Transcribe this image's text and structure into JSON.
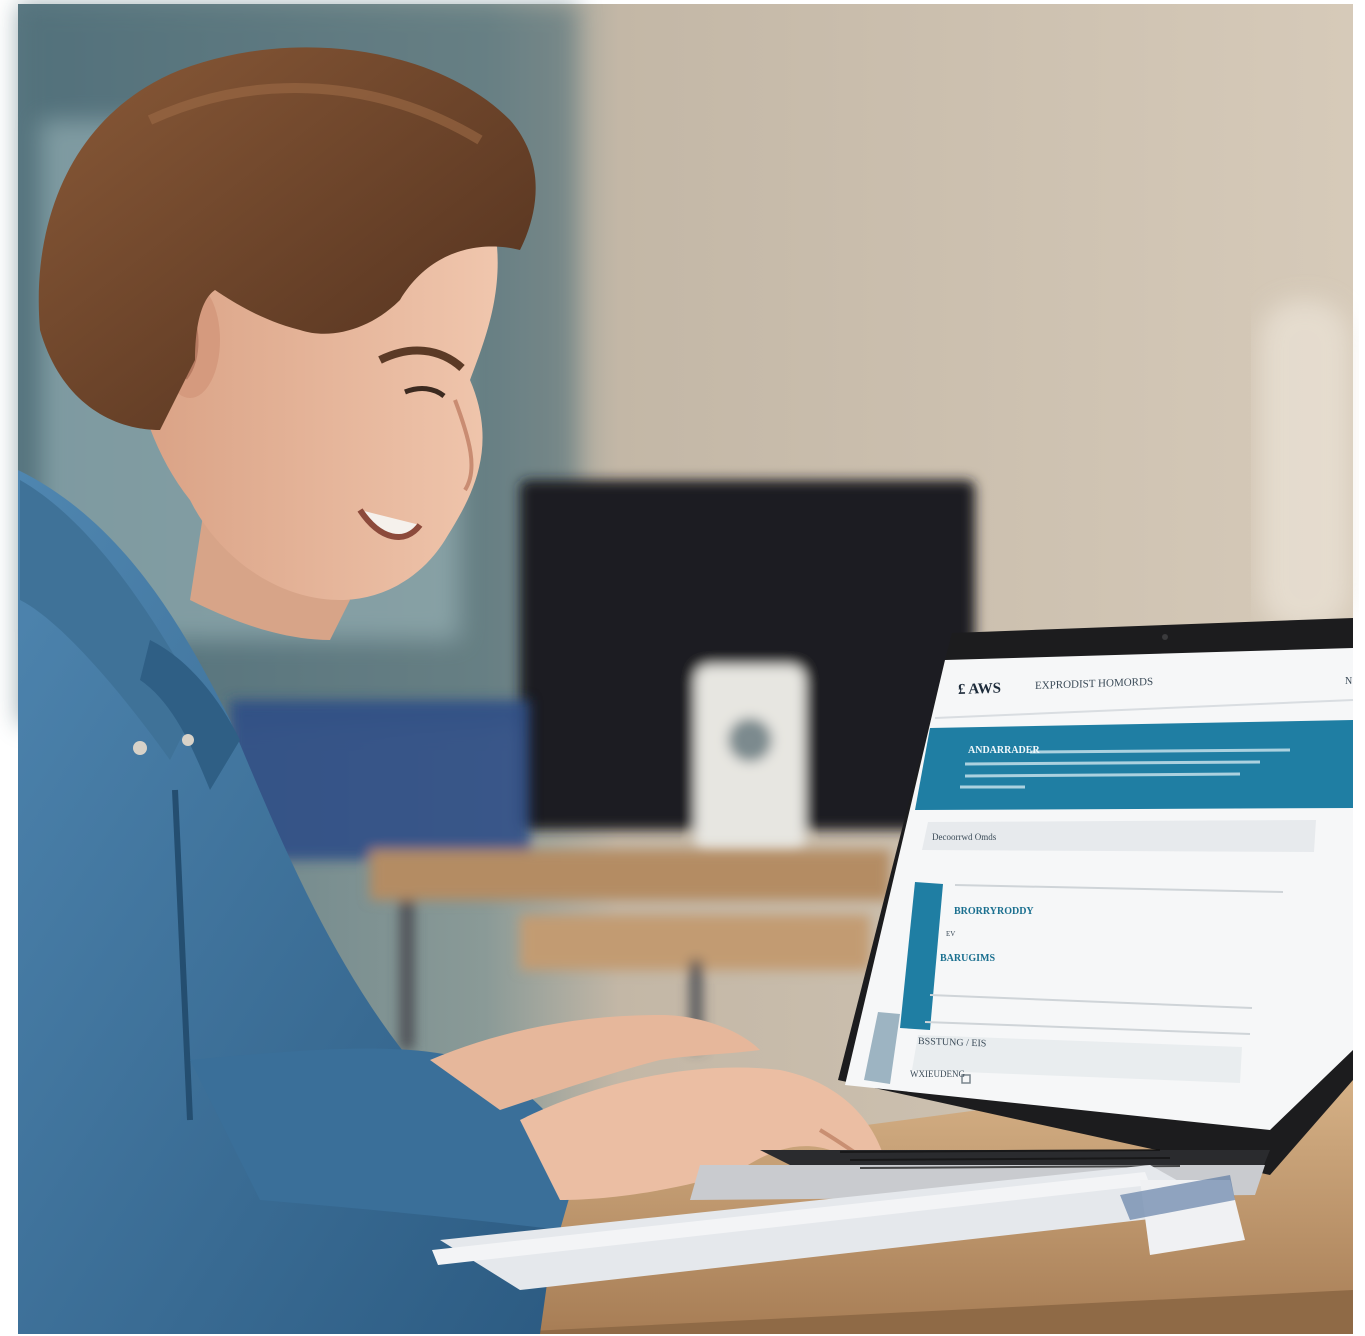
{
  "photo": {
    "palette": {
      "wall": "#c9bba9",
      "window": "#6f8b93",
      "monitor": "#1b1d20",
      "desk": "#b48c63",
      "shirt": "#3a6f99",
      "hair": "#6a4028",
      "skin": "#e6b79b",
      "laptop_frame": "#1c1c1e",
      "screen_banner": "#1f7ea3",
      "paper": "#eef0f3"
    }
  },
  "laptop_screen": {
    "logo_text": "£ AWS",
    "nav_title": "EXPRODIST HOMORDS",
    "edge_letter": "N",
    "banner_heading": "ANDARRADER",
    "breadcrumb": "Decoorrwd Omds",
    "card_heading": "BRORRYRODDY",
    "card_small": "EV",
    "card_subheading": "BARUGIMS",
    "form_row": "BSSTUNG / EIS",
    "form_checkbox_label": "WXIEUDENG"
  }
}
